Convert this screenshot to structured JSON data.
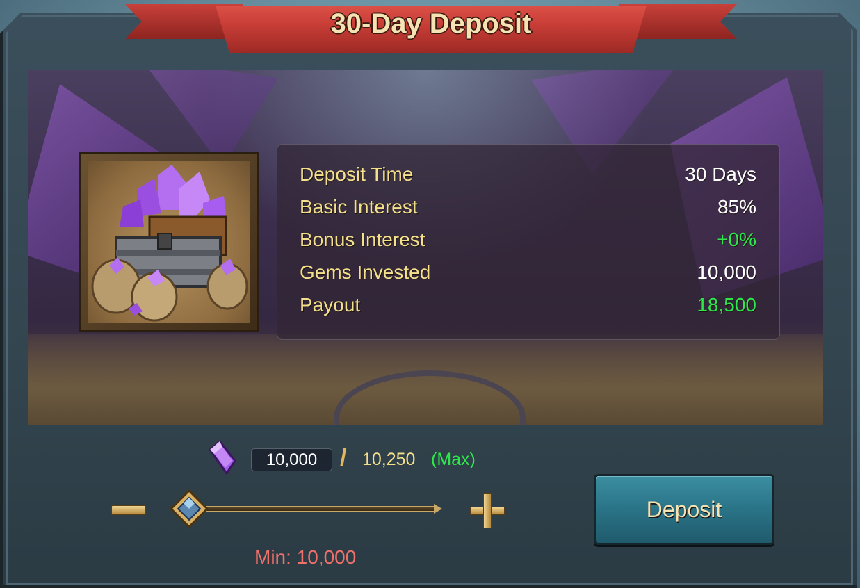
{
  "dialog": {
    "title": "30-Day Deposit"
  },
  "stats": [
    {
      "label": "Deposit Time",
      "value": "30 Days",
      "highlight": false
    },
    {
      "label": "Basic Interest",
      "value": "85%",
      "highlight": false
    },
    {
      "label": "Bonus Interest",
      "value": "+0%",
      "highlight": true
    },
    {
      "label": "Gems Invested",
      "value": "10,000",
      "highlight": false
    },
    {
      "label": "Payout",
      "value": "18,500",
      "highlight": true
    }
  ],
  "deposit": {
    "amount": "10,000",
    "separator": "/",
    "max_amount": "10,250",
    "max_label": "(Max)",
    "min_label": "Min: 10,000",
    "slider_fraction": 0.0,
    "button_label": "Deposit"
  },
  "icons": {
    "gem": "purple-gem-icon",
    "chest": "gem-chest-icon",
    "minus": "minus-icon",
    "plus": "plus-icon"
  },
  "colors": {
    "accent_green": "#2ee84a",
    "label_gold": "#f4df8a",
    "min_red": "#f0706a",
    "button_teal": "#2a7387"
  }
}
